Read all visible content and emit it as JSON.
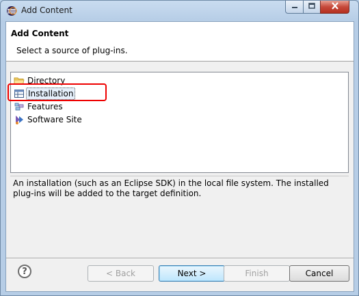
{
  "window": {
    "title": "Add Content"
  },
  "header": {
    "title": "Add Content",
    "description": "Select a source of plug-ins."
  },
  "tree": {
    "items": [
      {
        "label": "Directory",
        "icon": "folder-icon",
        "selected": false
      },
      {
        "label": "Installation",
        "icon": "installation-icon",
        "selected": true
      },
      {
        "label": "Features",
        "icon": "features-icon",
        "selected": false
      },
      {
        "label": "Software Site",
        "icon": "software-site-icon",
        "selected": false
      }
    ]
  },
  "description_text": "An installation (such as an Eclipse SDK) in the local file system. The installed plug-ins will be added to the target definition.",
  "buttons": {
    "help": "?",
    "back": "< Back",
    "next": "Next >",
    "finish": "Finish",
    "cancel": "Cancel"
  },
  "colors": {
    "highlight": "#e00000",
    "default_button_border": "#3c7fb1"
  }
}
